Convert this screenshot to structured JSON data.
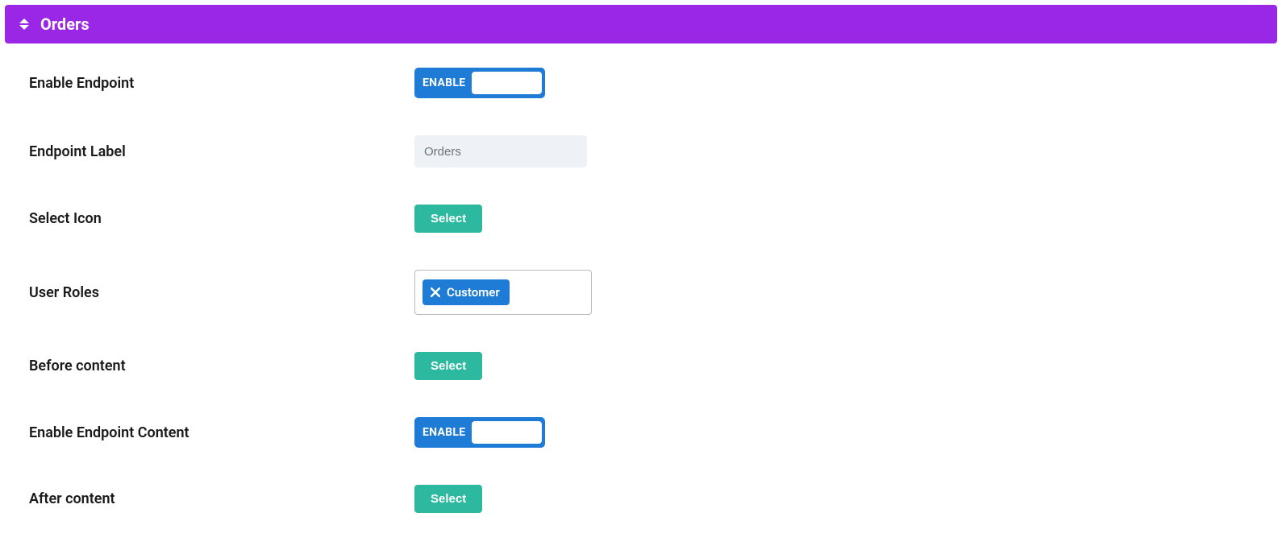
{
  "header": {
    "title": "Orders"
  },
  "fields": {
    "enable_endpoint": {
      "label": "Enable Endpoint",
      "toggle_text": "ENABLE"
    },
    "endpoint_label": {
      "label": "Endpoint Label",
      "placeholder": "Orders",
      "value": ""
    },
    "select_icon": {
      "label": "Select Icon",
      "button": "Select"
    },
    "user_roles": {
      "label": "User Roles",
      "tags": [
        "Customer"
      ]
    },
    "before_content": {
      "label": "Before content",
      "button": "Select"
    },
    "enable_endpoint_content": {
      "label": "Enable Endpoint Content",
      "toggle_text": "ENABLE"
    },
    "after_content": {
      "label": "After content",
      "button": "Select"
    }
  }
}
